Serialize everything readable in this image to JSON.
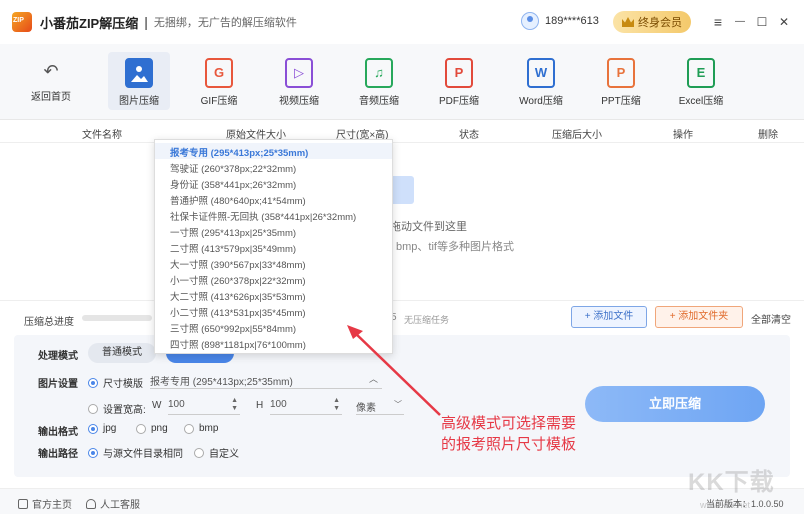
{
  "app": {
    "name": "小番茄ZIP解压缩",
    "separator": "|",
    "slogan": "无捆绑，无广告的解压缩软件",
    "user_phone": "189****613",
    "vip_label": "终身会员"
  },
  "window": {
    "menu": "≡",
    "minimize": "—",
    "maximize": "☐",
    "close": "✕"
  },
  "toolbar": {
    "back_label": "返回首页",
    "tools": [
      {
        "label": "图片压缩",
        "glyph": "",
        "color": "#2f6fd1"
      },
      {
        "label": "GIF压缩",
        "glyph": "G",
        "color": "#e8573c"
      },
      {
        "label": "视频压缩",
        "glyph": "▷",
        "color": "#8a4fd6"
      },
      {
        "label": "音频压缩",
        "glyph": "♫",
        "color": "#27a85b"
      },
      {
        "label": "PDF压缩",
        "glyph": "P",
        "color": "#e24a3b"
      },
      {
        "label": "Word压缩",
        "glyph": "W",
        "color": "#2f6fd1"
      },
      {
        "label": "PPT压缩",
        "glyph": "P",
        "color": "#e8733c"
      },
      {
        "label": "Excel压缩",
        "glyph": "E",
        "color": "#1f9d55"
      }
    ]
  },
  "table": {
    "headers": [
      "文件名称",
      "原始文件大小",
      "尺寸(宽×高)",
      "状态",
      "压缩后大小",
      "操作",
      "删除"
    ]
  },
  "drop": {
    "hint": "拖动文件到这里",
    "formats": "bmp、tif等多种图片格式"
  },
  "progress": {
    "label": "压缩总进度",
    "count": "5",
    "status": "无压缩任务",
    "value": 0
  },
  "actions": {
    "add_file": "+ 添加文件",
    "add_folder": "+ 添加文件夹",
    "clear_all": "全部清空"
  },
  "settings": {
    "mode_label": "处理模式",
    "mode_normal": "普通模式",
    "image_label": "图片设置",
    "size_template": "尺寸模版",
    "template_value": "报考专用 (295*413px;25*35mm)",
    "set_wh": "设置宽高:",
    "w_label": "W",
    "w_value": "100",
    "h_label": "H",
    "h_value": "100",
    "unit": "像素",
    "format_label": "输出格式",
    "formats": [
      "jpg",
      "png",
      "bmp"
    ],
    "path_label": "输出路径",
    "path_same": "与源文件目录相同",
    "path_custom": "自定义",
    "start": "立即压缩"
  },
  "dropdown": [
    "报考专用 (295*413px;25*35mm)",
    "驾驶证 (260*378px;22*32mm)",
    "身份证 (358*441px;26*32mm)",
    "普通护照 (480*640px;41*54mm)",
    "社保卡证件照-无回执 (358*441px|26*32mm)",
    "一寸照 (295*413px|25*35mm)",
    "二寸照 (413*579px|35*49mm)",
    "大一寸照 (390*567px|33*48mm)",
    "小一寸照 (260*378px|22*32mm)",
    "大二寸照 (413*626px|35*53mm)",
    "小二寸照 (413*531px|35*45mm)",
    "三寸照 (650*992px|55*84mm)",
    "四寸照 (898*1181px|76*100mm)"
  ],
  "annotation": {
    "line1": "高级模式可选择需要",
    "line2": "的报考照片尺寸模板"
  },
  "footer": {
    "homepage": "官方主页",
    "support": "人工客服",
    "version": "当前版本：1.0.0.50"
  },
  "watermark": {
    "big": "KK下载",
    "small": "www.kkx.net"
  }
}
